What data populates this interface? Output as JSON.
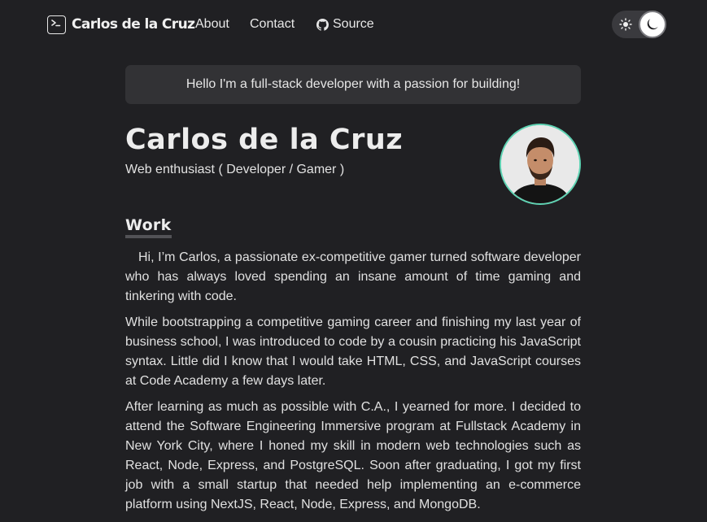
{
  "nav": {
    "brand": "Carlos de la Cruz",
    "links": [
      {
        "label": "About"
      },
      {
        "label": "Contact"
      },
      {
        "label": "Source",
        "icon": "github-icon"
      }
    ],
    "theme_toggle": {
      "state": "dark",
      "icons": [
        "sun-icon",
        "moon-icon"
      ]
    }
  },
  "banner": "Hello I'm a full-stack developer with a passion for building!",
  "profile": {
    "name": "Carlos de la Cruz",
    "subtitle": "Web enthusiast ( Developer / Gamer )"
  },
  "work": {
    "title": "Work",
    "paragraphs": [
      "Hi, I’m Carlos, a passionate ex-competitive gamer turned software developer who has always loved spending an insane amount of time gaming and tinkering with code.",
      "While bootstrapping a competitive gaming career and finishing my last year of business school, I was introduced to code by a cousin practicing his JavaScript syntax. Little did I know that I would take HTML, CSS, and JavaScript courses at Code Academy a few days later.",
      "After learning as much as possible with C.A., I yearned for more. I decided to attend the Software Engineering Immersive program at Fullstack Academy in New York City, where I honed my skill in modern web technologies such as React, Node, Express, and PostgreSQL. Soon after graduating, I got my first job with a small startup that needed help implementing an e-commerce platform using NextJS, React, Node, Express, and MongoDB."
    ]
  },
  "colors": {
    "background": "#202023",
    "banner_bg": "#323235",
    "avatar_ring": "#5ed3b3",
    "toggle_bg": "#3a3a3e"
  }
}
